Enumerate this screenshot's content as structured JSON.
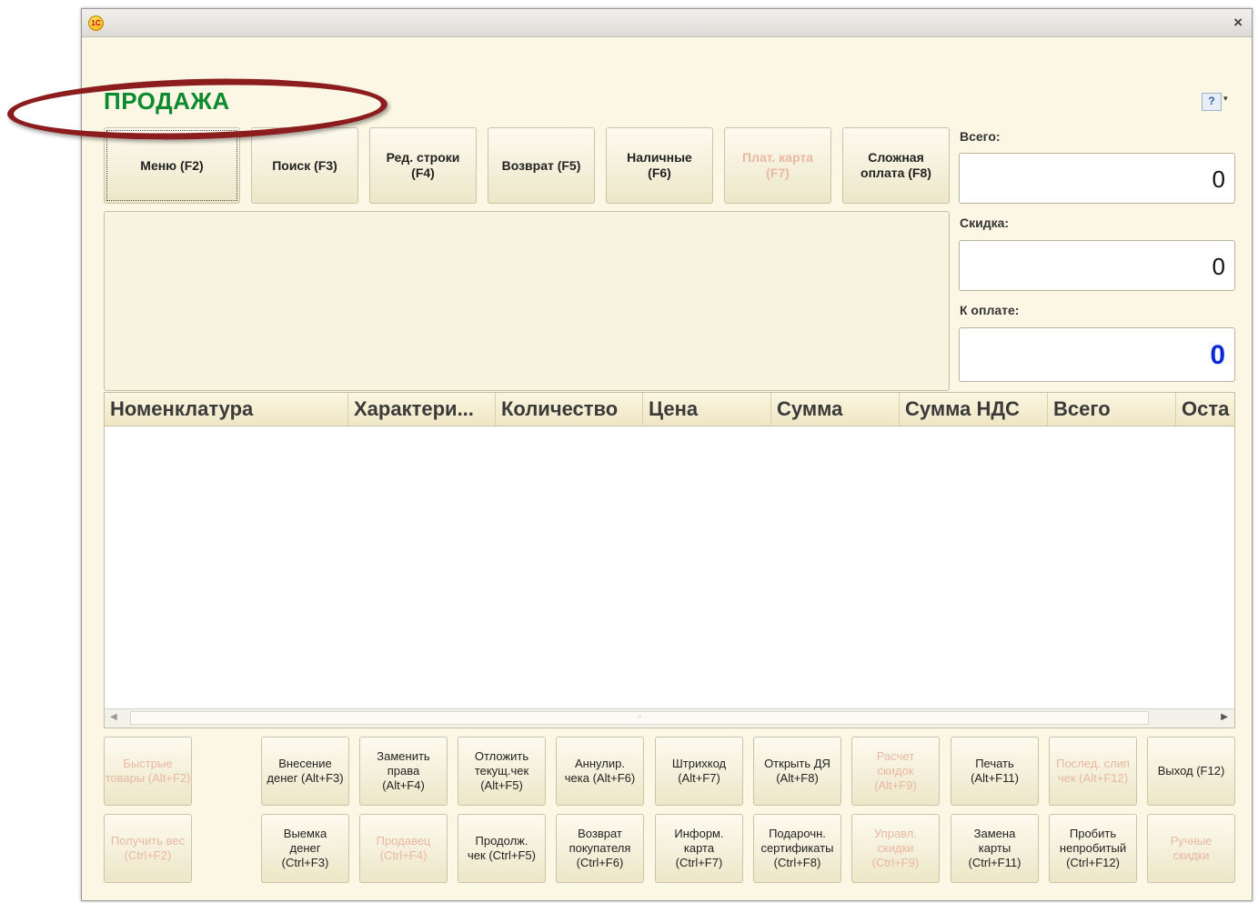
{
  "window": {
    "logo_text": "1С",
    "close_label": "×"
  },
  "header": {
    "title": "ПРОДАЖА",
    "help_label": "?",
    "help_arrow": "▾"
  },
  "toolbar": [
    {
      "label": "Меню (F2)",
      "enabled": true,
      "focused": true
    },
    {
      "label": "Поиск (F3)",
      "enabled": true
    },
    {
      "label": "Ред. строки\n(F4)",
      "enabled": true
    },
    {
      "label": "Возврат (F5)",
      "enabled": true
    },
    {
      "label": "Наличные\n(F6)",
      "enabled": true
    },
    {
      "label": "Плат. карта\n(F7)",
      "enabled": false
    },
    {
      "label": "Сложная\nоплата (F8)",
      "enabled": true
    }
  ],
  "totals": {
    "total_label": "Всего:",
    "total_value": "0",
    "discount_label": "Скидка:",
    "discount_value": "0",
    "to_pay_label": "К оплате:",
    "to_pay_value": "0",
    "to_pay_color": "#0a2bd6"
  },
  "table": {
    "columns": [
      "Номенклатура",
      "Характери...",
      "Количество",
      "Цена",
      "Сумма",
      "Сумма НДС",
      "Всего",
      "Оста"
    ],
    "rows": []
  },
  "bottom_row1": [
    {
      "label": "Быстрые\nтовары (Alt+F2)",
      "enabled": false
    },
    {
      "label": "Внесение\nденег (Alt+F3)",
      "enabled": true
    },
    {
      "label": "Заменить\nправа\n(Alt+F4)",
      "enabled": true
    },
    {
      "label": "Отложить\nтекущ.чек\n(Alt+F5)",
      "enabled": true
    },
    {
      "label": "Аннулир.\nчека (Alt+F6)",
      "enabled": true
    },
    {
      "label": "Штрихкод\n(Alt+F7)",
      "enabled": true
    },
    {
      "label": "Открыть ДЯ\n(Alt+F8)",
      "enabled": true
    },
    {
      "label": "Расчет\nскидок\n(Alt+F9)",
      "enabled": false
    },
    {
      "label": "Печать\n(Alt+F11)",
      "enabled": true
    },
    {
      "label": "Послед. слип\nчек (Alt+F12)",
      "enabled": false
    },
    {
      "label": "Выход (F12)",
      "enabled": true
    }
  ],
  "bottom_row2": [
    {
      "label": "Получить вес\n(Ctrl+F2)",
      "enabled": false
    },
    {
      "label": "Выемка\nденег\n(Ctrl+F3)",
      "enabled": true
    },
    {
      "label": "Продавец\n(Ctrl+F4)",
      "enabled": false
    },
    {
      "label": "Продолж.\nчек (Ctrl+F5)",
      "enabled": true
    },
    {
      "label": "Возврат\nпокупателя\n(Ctrl+F6)",
      "enabled": true
    },
    {
      "label": "Информ.\nкарта\n(Ctrl+F7)",
      "enabled": true
    },
    {
      "label": "Подарочн.\nсертификаты\n(Ctrl+F8)",
      "enabled": true
    },
    {
      "label": "Управл.\nскидки\n(Ctrl+F9)",
      "enabled": false
    },
    {
      "label": "Замена\nкарты\n(Ctrl+F11)",
      "enabled": true
    },
    {
      "label": "Пробить\nнепробитый\n(Ctrl+F12)",
      "enabled": true
    },
    {
      "label": "Ручные\nскидки",
      "enabled": false
    }
  ]
}
